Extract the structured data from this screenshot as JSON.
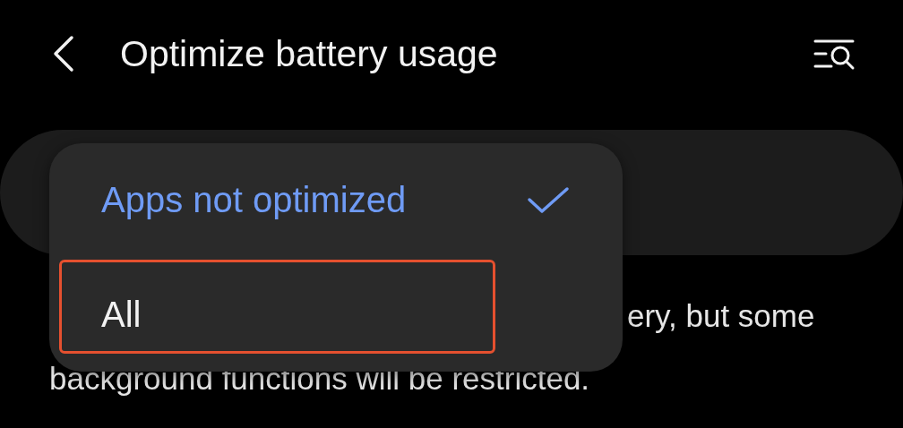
{
  "header": {
    "title": "Optimize battery usage"
  },
  "menu": {
    "items": [
      {
        "label": "Apps not optimized",
        "selected": true,
        "highlighted": false
      },
      {
        "label": "All",
        "selected": false,
        "highlighted": true
      }
    ]
  },
  "description": {
    "lines": [
      "ery, but some",
      "background functions will be restricted."
    ]
  }
}
